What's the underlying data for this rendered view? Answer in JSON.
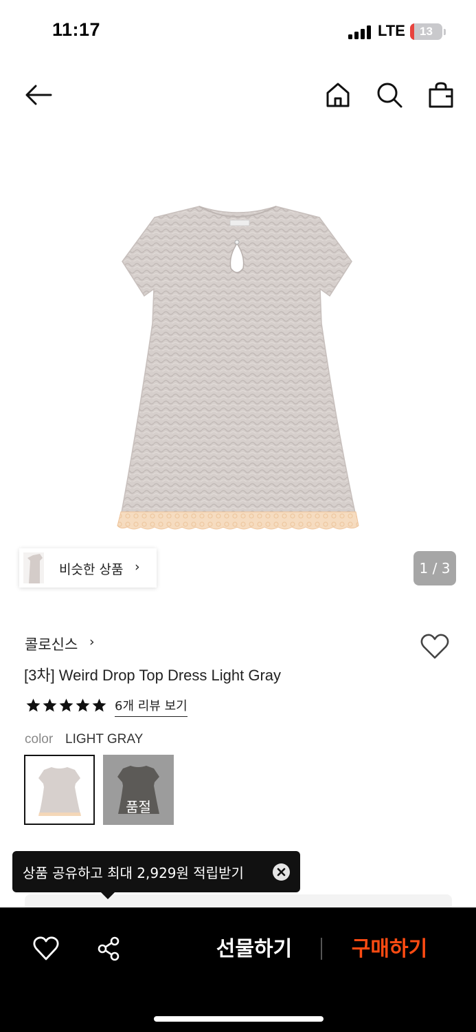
{
  "status_bar": {
    "time": "11:17",
    "network": "LTE",
    "battery": "13",
    "battery_level": 0.13,
    "battery_color": "#e8433d"
  },
  "nav": {
    "back_icon": "arrow-left-icon",
    "home_icon": "home-icon",
    "search_icon": "search-icon",
    "bag_icon": "shopping-bag-icon"
  },
  "gallery": {
    "similar_label": "비슷한 상품",
    "similar_arrow": "›",
    "page_counter": "1 / 3"
  },
  "product": {
    "brand": "콜로신스",
    "brand_chevron": "›",
    "title": "[3차] Weird Drop Top Dress Light Gray",
    "rating": 5,
    "rating_max": 5,
    "review_link": "6개 리뷰 보기",
    "color_label": "color",
    "color_value": "LIGHT GRAY",
    "swatches": [
      {
        "selected": true,
        "sold_out": false
      },
      {
        "selected": false,
        "sold_out": true,
        "sold_out_label": "품절"
      }
    ]
  },
  "tooltip": {
    "text": "상품 공유하고 최대 2,929원 적립받기",
    "close_icon": "close-icon"
  },
  "bottom_bar": {
    "wish_icon": "heart-icon",
    "share_icon": "share-icon",
    "gift_label": "선물하기",
    "buy_label": "구매하기",
    "buy_color": "#ff4b12"
  }
}
